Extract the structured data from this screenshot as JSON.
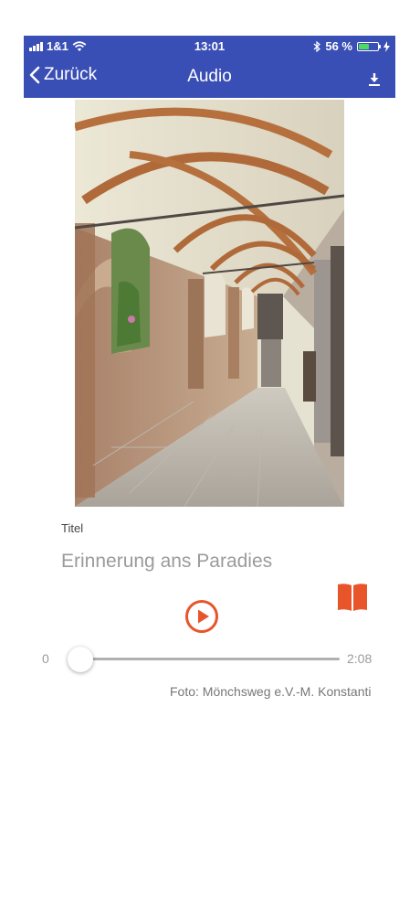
{
  "status_bar": {
    "carrier": "1&1",
    "time": "13:01",
    "battery_text": "56 %",
    "battery_level": 0.56
  },
  "nav": {
    "back_label": "Zurück",
    "title": "Audio",
    "download_icon": "download-icon"
  },
  "photo": {
    "subject": "cloister-corridor-photo"
  },
  "details": {
    "label": "Titel",
    "value": "Erinnerung ans Paradies"
  },
  "player": {
    "start_time": "0",
    "end_time": "2:08",
    "progress": 0.0,
    "play_icon": "play-circle-icon",
    "book_icon": "book-icon"
  },
  "credit": "Foto: Mönchsweg e.V.-M. Konstanti",
  "colors": {
    "accent": "#e8552b",
    "header": "#3a4fb5",
    "battery": "#4cd964"
  }
}
